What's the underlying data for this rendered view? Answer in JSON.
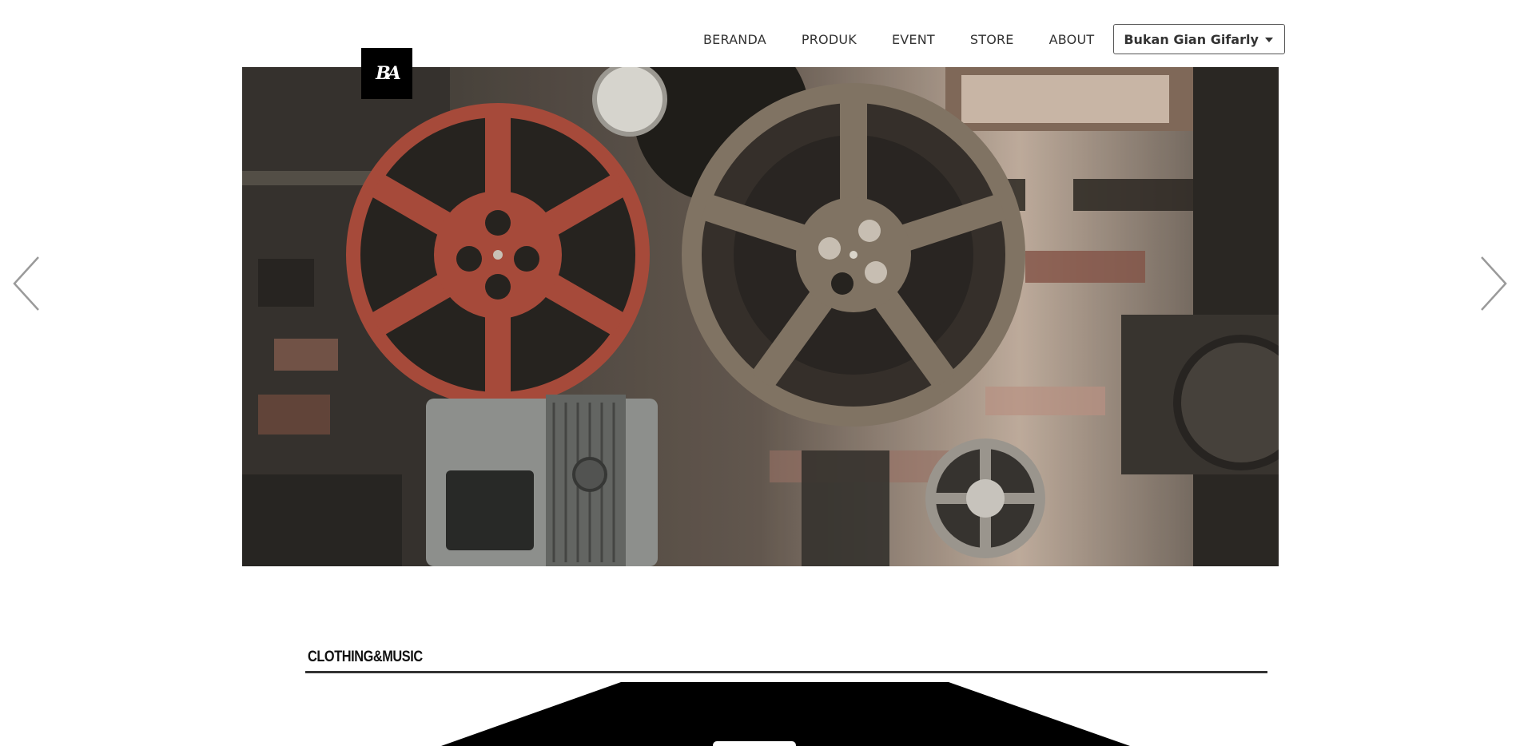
{
  "nav": {
    "links": [
      {
        "label": "BERANDA"
      },
      {
        "label": "PRODUK"
      },
      {
        "label": "EVENT"
      },
      {
        "label": "STORE"
      },
      {
        "label": "ABOUT"
      }
    ],
    "user_menu_label": "Bukan Gian Gifarly"
  },
  "carousel": {
    "image_subject": "vintage film reels and projectors",
    "prev_icon": "chevron-left-icon",
    "next_icon": "chevron-right-icon"
  },
  "logo": {
    "mark": "BA"
  },
  "section": {
    "title": "CLOTHING&MUSIC"
  }
}
